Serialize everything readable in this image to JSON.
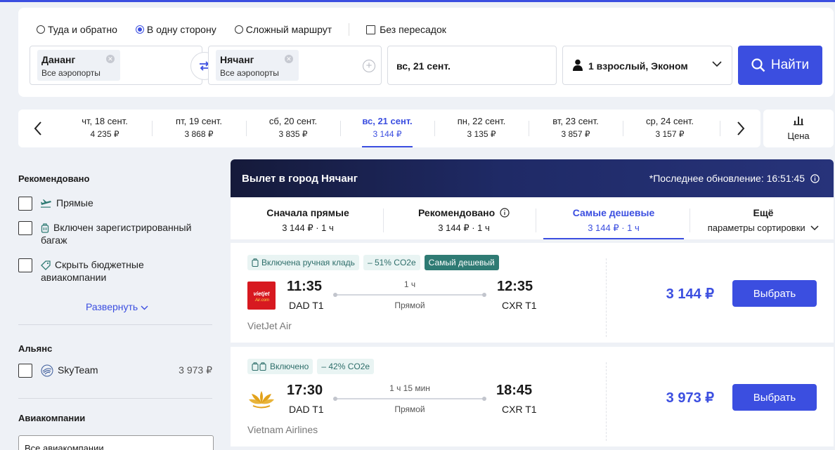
{
  "search": {
    "trip_types": [
      {
        "label": "Туда и обратно",
        "selected": false
      },
      {
        "label": "В одну сторону",
        "selected": true
      },
      {
        "label": "Сложный маршрут",
        "selected": false
      }
    ],
    "nonstop_label": "Без пересадок",
    "from": {
      "city": "Дананг",
      "sub": "Все аэропорты"
    },
    "to": {
      "city": "Нячанг",
      "sub": "Все аэропорты"
    },
    "date": "вс, 21 сент.",
    "passengers": "1 взрослый, Эконом",
    "find_label": "Найти"
  },
  "date_strip": {
    "dates": [
      {
        "day": "чт, 18 сент.",
        "price": "4 235 ₽"
      },
      {
        "day": "пт, 19 сент.",
        "price": "3 868 ₽"
      },
      {
        "day": "сб, 20 сент.",
        "price": "3 835 ₽"
      },
      {
        "day": "вс, 21 сент.",
        "price": "3 144 ₽",
        "active": true
      },
      {
        "day": "пн, 22 сент.",
        "price": "3 135 ₽"
      },
      {
        "day": "вт, 23 сент.",
        "price": "3 857 ₽"
      },
      {
        "day": "ср, 24 сент.",
        "price": "3 157 ₽"
      }
    ],
    "price_sort_label": "Цена"
  },
  "sidebar": {
    "recommended_heading": "Рекомендовано",
    "recommended": [
      {
        "label": "Прямые",
        "icon": "plane-icon"
      },
      {
        "label": "Включен зарегистрированный багаж",
        "icon": "luggage-icon"
      },
      {
        "label": "Скрыть бюджетные авиакомпании",
        "icon": "tag-icon"
      }
    ],
    "expand_label": "Развернуть",
    "alliance_heading": "Альянс",
    "alliances": [
      {
        "label": "SkyTeam",
        "price": "3 973 ₽"
      }
    ],
    "airlines_heading": "Авиакомпании",
    "airlines_all": "Все авиакомпании"
  },
  "results": {
    "banner_title": "Вылет в город Нячанг",
    "last_update": "*Последнее обновление: 16:51:45",
    "sort_tabs": [
      {
        "title": "Сначала прямые",
        "sub": "3 144 ₽ · 1 ч"
      },
      {
        "title": "Рекомендовано",
        "sub": "3 144 ₽ · 1 ч"
      },
      {
        "title": "Самые дешевые",
        "sub": "3 144 ₽ · 1 ч",
        "active": true
      },
      {
        "title": "Ещё",
        "sub": "параметры сортировки"
      }
    ],
    "flights": [
      {
        "badges": [
          "Включена ручная кладь",
          "– 51% CO2e",
          "Самый дешевый"
        ],
        "dep_time": "11:35",
        "dep_code": "DAD T1",
        "arr_time": "12:35",
        "arr_code": "CXR T1",
        "duration": "1 ч",
        "stops": "Прямой",
        "airline": "VietJet Air",
        "logo_text": "vietjetAir.com",
        "price": "3 144 ₽",
        "select_label": "Выбрать"
      },
      {
        "badges": [
          "Включено",
          "– 42% CO2e"
        ],
        "dep_time": "17:30",
        "dep_code": "DAD T1",
        "arr_time": "18:45",
        "arr_code": "CXR T1",
        "duration": "1 ч 15 мин",
        "stops": "Прямой",
        "airline": "Vietnam Airlines",
        "price": "3 973 ₽",
        "select_label": "Выбрать"
      }
    ]
  },
  "colors": {
    "accent": "#3b4ee0",
    "badge_bg": "#e9f4f3",
    "badge_dark": "#2f7b74"
  }
}
